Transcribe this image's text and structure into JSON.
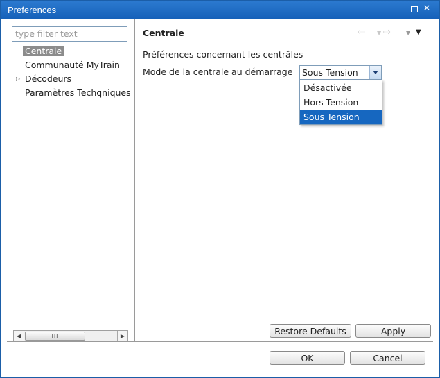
{
  "window": {
    "title": "Preferences"
  },
  "filter": {
    "placeholder": "type filter text",
    "value": ""
  },
  "tree": {
    "items": [
      {
        "label": "Centrale",
        "selected": true,
        "expandable": false
      },
      {
        "label": "Communauté MyTrain",
        "selected": false,
        "expandable": false
      },
      {
        "label": "Décodeurs",
        "selected": false,
        "expandable": true
      },
      {
        "label": "Paramètres Techqniques",
        "selected": false,
        "expandable": false
      }
    ]
  },
  "page": {
    "title": "Centrale",
    "description": "Préférences concernant les centrâles",
    "mode_label": "Mode de la centrale au démarrage",
    "mode_value": "Sous Tension",
    "mode_options": [
      "Désactivée",
      "Hors Tension",
      "Sous Tension"
    ]
  },
  "buttons": {
    "restore_defaults": "Restore Defaults",
    "apply": "Apply",
    "ok": "OK",
    "cancel": "Cancel"
  },
  "icons": {
    "back": "back-arrow-icon",
    "forward_menu": "forward-menu-icon",
    "forward": "forward-arrow-icon",
    "view_menu": "view-menu-icon",
    "maximize": "maximize-icon",
    "close": "close-icon"
  },
  "colors": {
    "titlebar": "#1560b8",
    "selection": "#1667c0",
    "tree_selection": "#8c8c8c"
  }
}
